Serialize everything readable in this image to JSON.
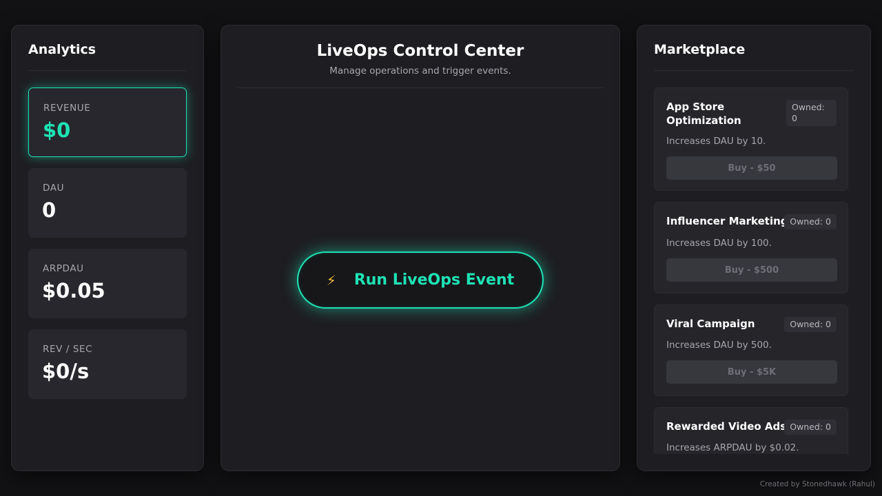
{
  "analytics": {
    "title": "Analytics",
    "stats": [
      {
        "label": "REVENUE",
        "value": "$0"
      },
      {
        "label": "DAU",
        "value": "0"
      },
      {
        "label": "ARPDAU",
        "value": "$0.05"
      },
      {
        "label": "REV / SEC",
        "value": "$0/s"
      }
    ]
  },
  "control": {
    "title": "LiveOps Control Center",
    "subtitle": "Manage operations and trigger events.",
    "run_icon": "lightning-icon",
    "run_label": "Run LiveOps Event"
  },
  "marketplace": {
    "title": "Marketplace",
    "items": [
      {
        "title_line1": "App Store",
        "title_line2": "Optimization",
        "owned_line1": "Owned:",
        "owned_line2": "0",
        "desc": "Increases DAU by 10.",
        "buy": "Buy - $50"
      },
      {
        "title": "Influencer Marketing",
        "owned": "Owned: 0",
        "desc": "Increases DAU by 100.",
        "buy": "Buy - $500"
      },
      {
        "title": "Viral Campaign",
        "owned": "Owned: 0",
        "desc": "Increases DAU by 500.",
        "buy": "Buy - $5K"
      },
      {
        "title": "Rewarded Video Ads",
        "owned": "Owned: 0",
        "desc": "Increases ARPDAU by $0.02."
      }
    ]
  },
  "footer": "Created by Stonedhawk (Rahul)",
  "colors": {
    "accent": "#1ee3b5",
    "bolt": "#f5b82e",
    "panel": "#1e1e22"
  }
}
